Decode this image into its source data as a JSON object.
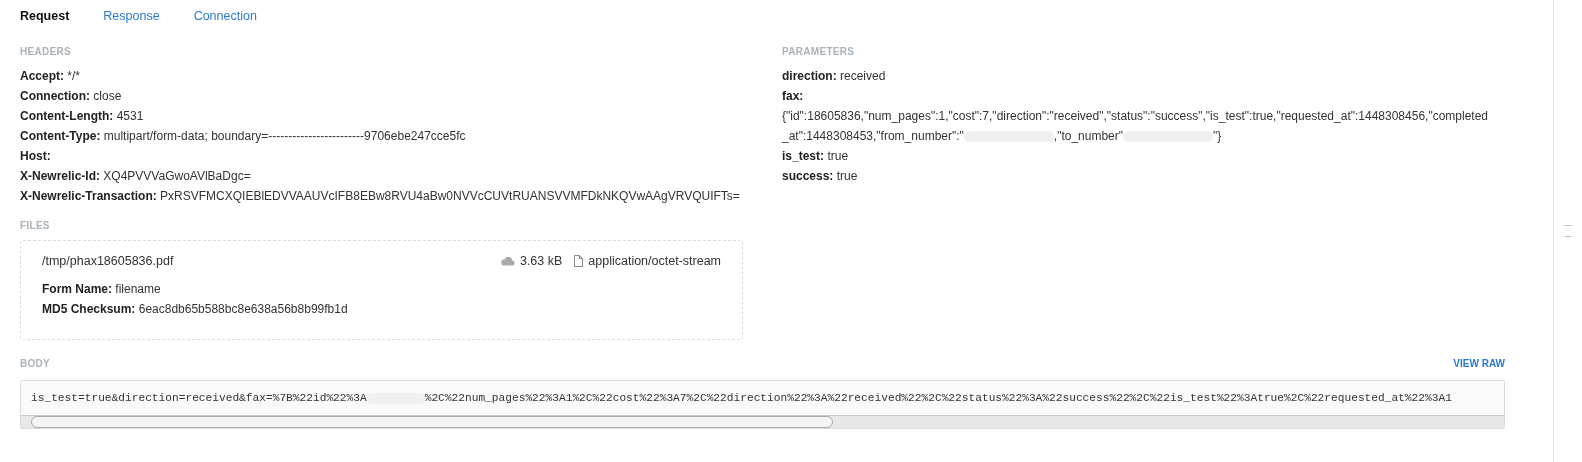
{
  "tabs": [
    {
      "label": "Request",
      "selected": true
    },
    {
      "label": "Response",
      "selected": false
    },
    {
      "label": "Connection",
      "selected": false
    }
  ],
  "headers": {
    "title": "HEADERS",
    "items": [
      {
        "key": "Accept:",
        "value": "*/*"
      },
      {
        "key": "Connection:",
        "value": "close"
      },
      {
        "key": "Content-Length:",
        "value": "4531"
      },
      {
        "key": "Content-Type:",
        "value": "multipart/form-data; boundary=------------------------9706ebe247cce5fc"
      },
      {
        "key": "Host:",
        "value": ""
      },
      {
        "key": "X-Newrelic-Id:",
        "value": "XQ4PVVVaGwoAVlBaDgc="
      },
      {
        "key": "X-Newrelic-Transaction:",
        "value": "PxRSVFMCXQIEBlEDVVAAUVcIFB8EBw8RVU4aBw0NVVcCUVtRUANSVVMFDkNKQVwAAgVRVQUIFTs="
      }
    ]
  },
  "parameters": {
    "title": "PARAMETERS",
    "items": [
      {
        "key": "direction:",
        "kind": "inline",
        "segments": [
          "received"
        ]
      },
      {
        "key": "fax:",
        "kind": "block",
        "segments": [
          "{\"id\":18605836,\"num_pages\":1,\"cost\":7,\"direction\":\"received\",\"status\":\"success\",\"is_test\":true,\"requested_at\":1448308456,\"completed_at\":1448308453,\"from_number\":\"",
          ",\"to_number\"",
          "\"}"
        ]
      },
      {
        "key": "is_test:",
        "kind": "inline",
        "segments": [
          "true"
        ]
      },
      {
        "key": "success:",
        "kind": "inline",
        "segments": [
          "true"
        ]
      }
    ]
  },
  "files": {
    "title": "FILES",
    "items": [
      {
        "path": "/tmp/phax18605836.pdf",
        "size": "3.63 kB",
        "type": "application/octet-stream",
        "fields": [
          {
            "key": "Form Name:",
            "value": "filename"
          },
          {
            "key": "MD5 Checksum:",
            "value": "6eac8db65b588bc8e638a56b8b99fb1d"
          }
        ]
      }
    ]
  },
  "body": {
    "title": "BODY",
    "action": "VIEW RAW",
    "segments": [
      "is_test=true&direction=received&fax=%7B%22id%22%3A",
      "%2C%22num_pages%22%3A1%2C%22cost%22%3A7%2C%22direction%22%3A%22received%22%2C%22status%22%3A%22success%22%2C%22is_test%22%3Atrue%2C%22requested_at%22%3A1"
    ]
  }
}
